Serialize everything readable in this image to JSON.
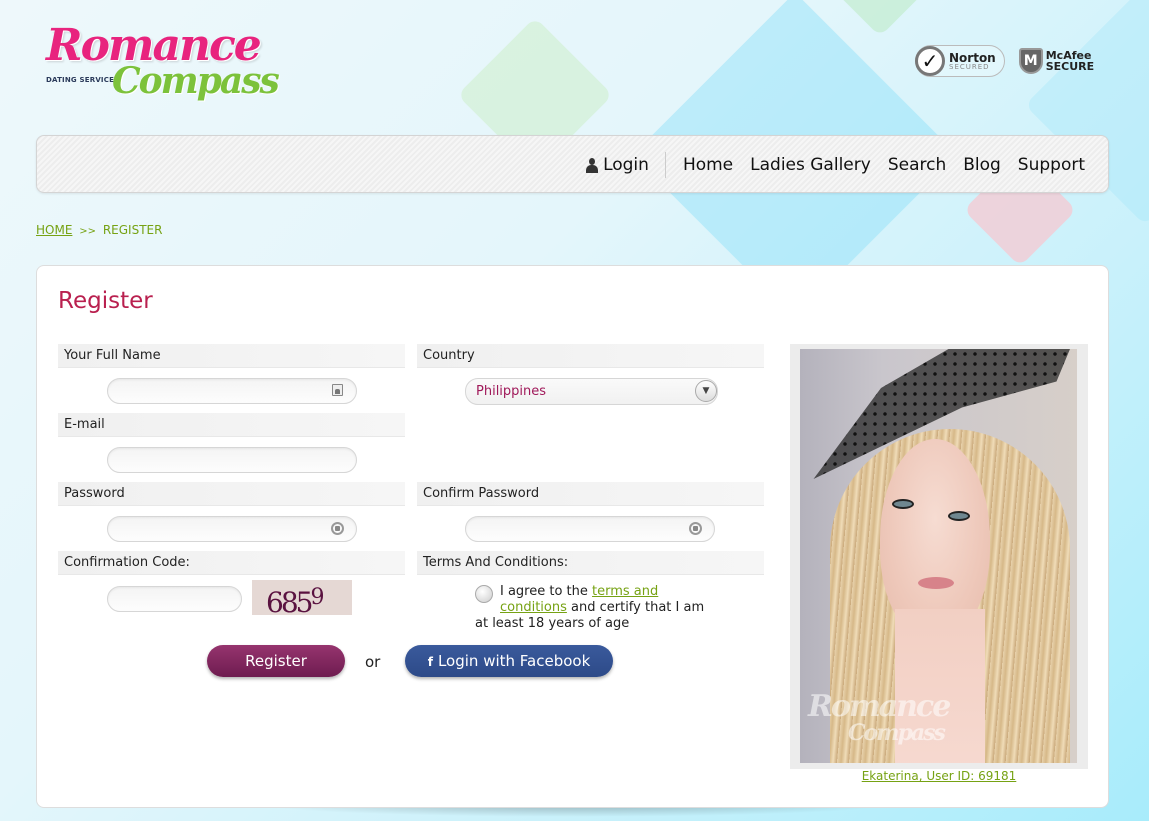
{
  "header": {
    "logo": {
      "line1": "Romance",
      "line2": "Compass",
      "tagline": "DATING SERVICE"
    },
    "badges": {
      "norton": {
        "name": "Norton",
        "sub": "SECURED",
        "icon": "checkmark-icon"
      },
      "mcafee": {
        "name": "McAfee",
        "sub": "SECURE",
        "icon": "shield-m-icon"
      }
    }
  },
  "nav": {
    "login": "Login",
    "links": [
      "Home",
      "Ladies Gallery",
      "Search",
      "Blog",
      "Support"
    ]
  },
  "breadcrumb": {
    "home": "HOME",
    "separator": ">>",
    "current": "REGISTER"
  },
  "form": {
    "title": "Register",
    "fields": {
      "full_name": {
        "label": "Your Full Name",
        "value": "",
        "icon": "contact-card-icon"
      },
      "country": {
        "label": "Country",
        "selected": "Philippines"
      },
      "email": {
        "label": "E-mail",
        "value": ""
      },
      "password": {
        "label": "Password",
        "value": "",
        "icon": "lock-icon"
      },
      "confirm_password": {
        "label": "Confirm Password",
        "value": "",
        "icon": "lock-icon"
      },
      "confirmation_code": {
        "label": "Confirmation Code:",
        "value": "",
        "captcha_main": "685",
        "captcha_sup": "9"
      },
      "terms": {
        "label": "Terms And Conditions:",
        "text_before": "I agree to the ",
        "link_part1": "terms and",
        "link_part2": "conditions",
        "text_after": " and certify that I am",
        "text_line3": "at least 18 years of age",
        "checked": false
      }
    },
    "buttons": {
      "register": "Register",
      "or": "or",
      "facebook_icon": "f",
      "facebook": "Login with Facebook"
    }
  },
  "profile": {
    "caption": "Ekaterina, User ID: 69181",
    "watermark_line1": "Romance",
    "watermark_line2": "Compass"
  },
  "colors": {
    "brand_pink": "#e8247e",
    "brand_green": "#7cc23b",
    "title": "#b9204f",
    "link_green": "#76a213",
    "register_button": "#7e2459",
    "facebook_button": "#2f4d8c"
  }
}
